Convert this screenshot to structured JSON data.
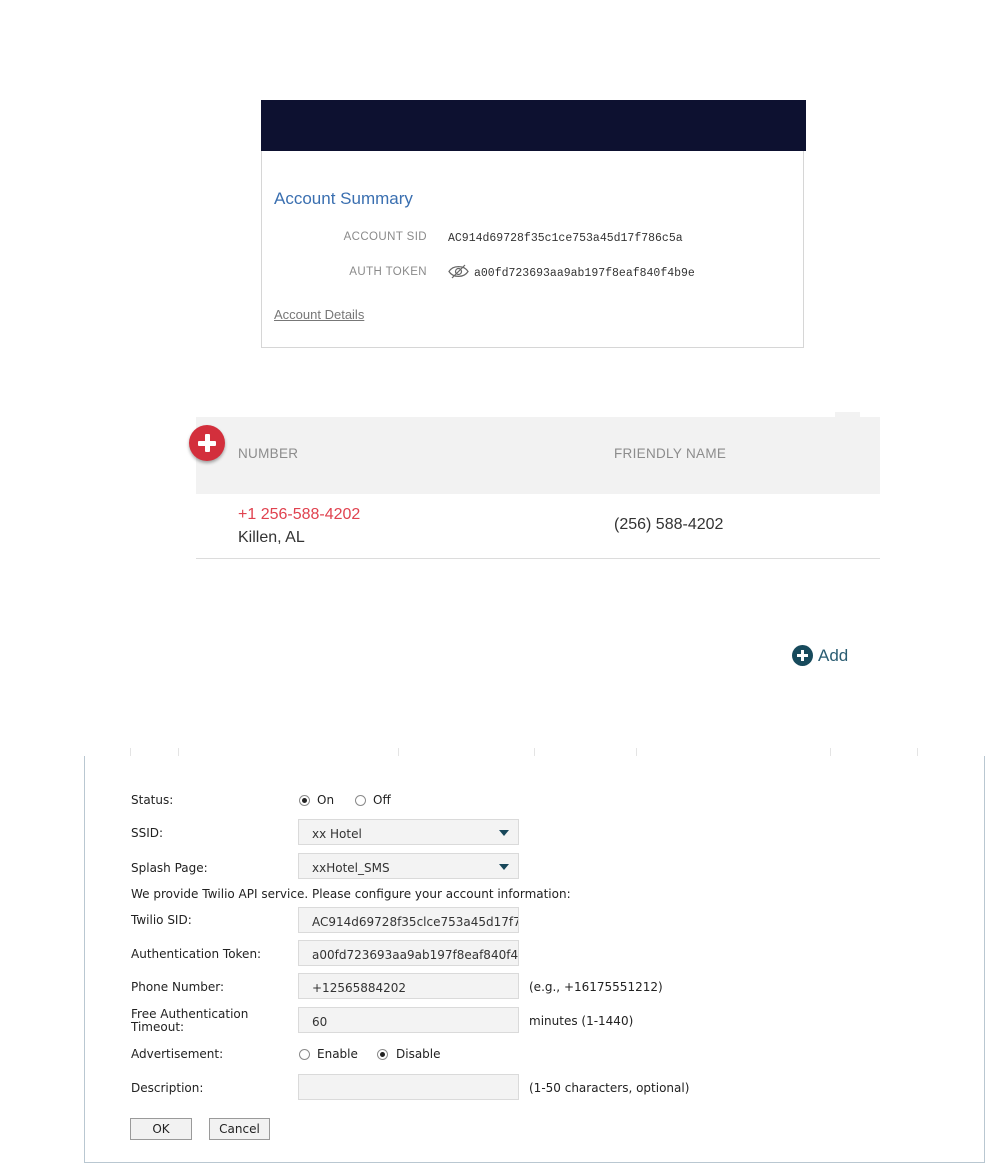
{
  "account_summary": {
    "title": "Account Summary",
    "account_sid_label": "ACCOUNT SID",
    "account_sid_value": "AC914d69728f35c1ce753a45d17f786c5a",
    "auth_token_label": "AUTH TOKEN",
    "auth_token_value": "a00fd723693aa9ab197f8eaf840f4b9e",
    "details_link": "Account Details",
    "banner_color": "#0d1130",
    "title_color": "#3a6fb0"
  },
  "numbers_table": {
    "columns": [
      "NUMBER",
      "FRIENDLY NAME"
    ],
    "rows": [
      {
        "number": "+1 256-588-4202",
        "location": "Killen, AL",
        "friendly_name": "(256) 588-4202"
      }
    ],
    "add_badge_color": "#d32f3c",
    "number_color": "#e0424f"
  },
  "add_button": {
    "label": "Add",
    "icon": "plus-circle-icon"
  },
  "form": {
    "status_label": "Status:",
    "status_options": [
      "On",
      "Off"
    ],
    "status_selected": "On",
    "ssid_label": "SSID:",
    "ssid_value": "xx Hotel",
    "splash_label": "Splash Page:",
    "splash_value": "xxHotel_SMS",
    "twilio_note": "We provide Twilio API service. Please configure your account information:",
    "twilio_sid_label": "Twilio SID:",
    "twilio_sid_value": "AC914d69728f35clce753a45d17f7",
    "auth_token_label": "Authentication Token:",
    "auth_token_value": "a00fd723693aa9ab197f8eaf840f4",
    "phone_label": "Phone Number:",
    "phone_value": "+12565884202",
    "phone_hint": "(e.g., +16175551212)",
    "timeout_label_line1": "Free Authentication",
    "timeout_label_line2": "Timeout:",
    "timeout_value": "60",
    "timeout_hint": "minutes (1-1440)",
    "ad_label": "Advertisement:",
    "ad_options": [
      "Enable",
      "Disable"
    ],
    "ad_selected": "Disable",
    "description_label": "Description:",
    "description_value": "",
    "description_hint": "(1-50 characters, optional)",
    "ok_label": "OK",
    "cancel_label": "Cancel"
  }
}
